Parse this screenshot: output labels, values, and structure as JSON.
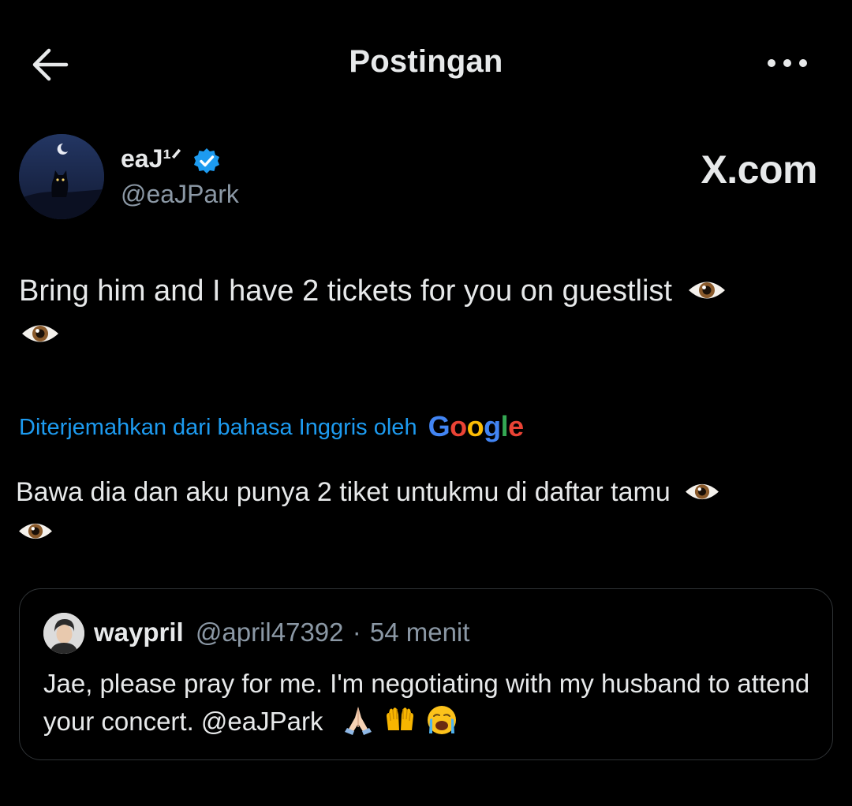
{
  "header": {
    "title": "Postingan",
    "back_icon": "arrow-left-icon",
    "more_icon": "more-horizontal-icon"
  },
  "author": {
    "name": "eaJ¹ᐟ",
    "handle": "@eaJPark",
    "verified": true,
    "verified_color": "#1d9bf0"
  },
  "watermark": "X.com",
  "post": {
    "text": "Bring him and I have 2 tickets for you on guestlist"
  },
  "translation": {
    "label": "Diterjemahkan dari bahasa Inggris oleh",
    "provider": "Google",
    "text": "Bawa dia dan aku punya 2 tiket untukmu di daftar tamu"
  },
  "quote": {
    "name": "waypril",
    "handle": "@april47392",
    "separator": "·",
    "time": "54 menit",
    "text": "Jae, please pray for me. I'm negotiating with my husband to attend your concert. @eaJPark",
    "emojis": [
      "folded-hands-icon",
      "raised-hands-icon",
      "crying-face-icon"
    ]
  },
  "colors": {
    "background": "#000000",
    "text": "#e7e9ea",
    "secondary": "#8b98a5",
    "link": "#1d9bf0",
    "border": "#2f3336"
  }
}
